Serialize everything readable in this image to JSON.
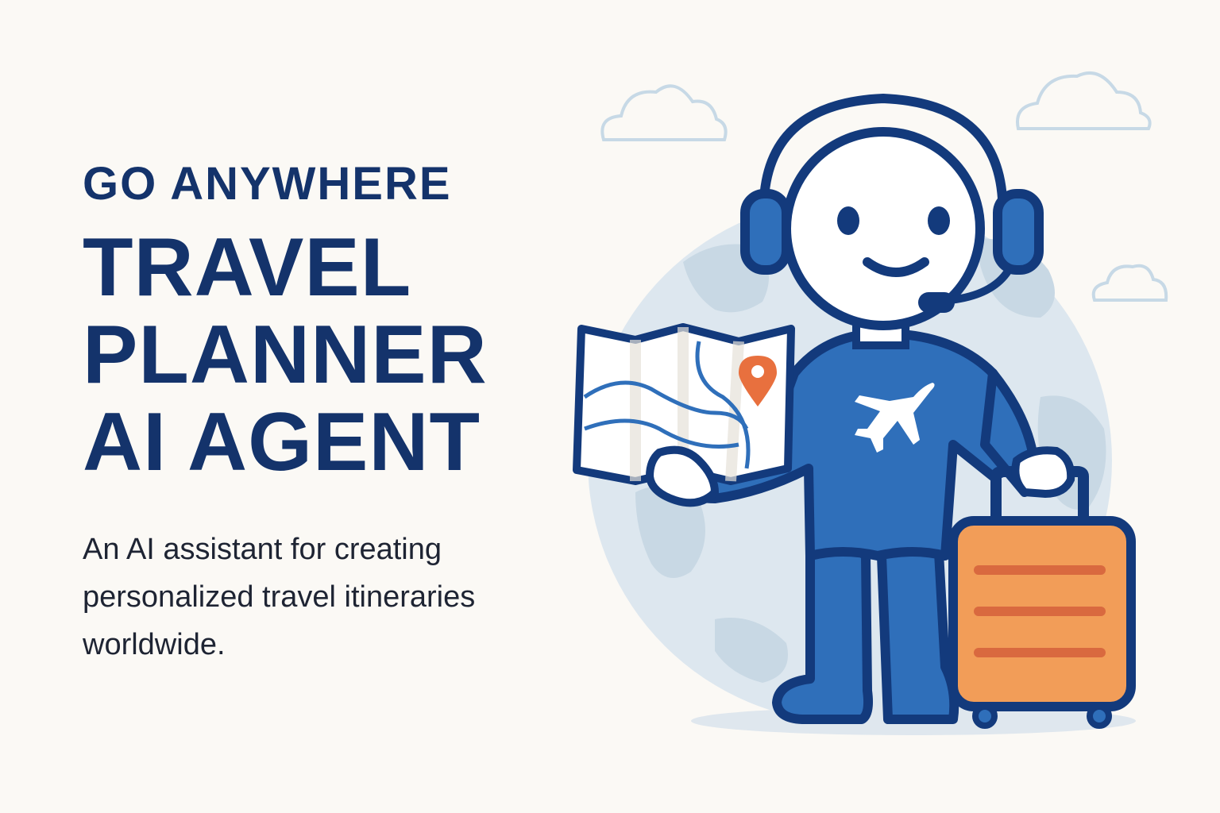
{
  "hero": {
    "eyebrow": "GO ANYWHERE",
    "title_lines": [
      "TRAVEL",
      "PLANNER",
      "AI AGENT"
    ],
    "subtitle": "An AI assistant for creating personalized travel itineraries worldwide."
  },
  "illustration": {
    "character": "travel-agent-mascot",
    "icons": [
      "headset-icon",
      "airplane-icon",
      "map-icon",
      "location-pin-icon",
      "suitcase-icon",
      "globe-icon",
      "cloud-icon"
    ]
  },
  "colors": {
    "background": "#fbf9f5",
    "headline": "#14336b",
    "body_text": "#1e2433",
    "character_blue": "#2f6fba",
    "outline": "#133a7c",
    "suitcase_orange": "#f29d58",
    "pin_orange": "#e8703e",
    "globe": "#dbe6ef"
  }
}
